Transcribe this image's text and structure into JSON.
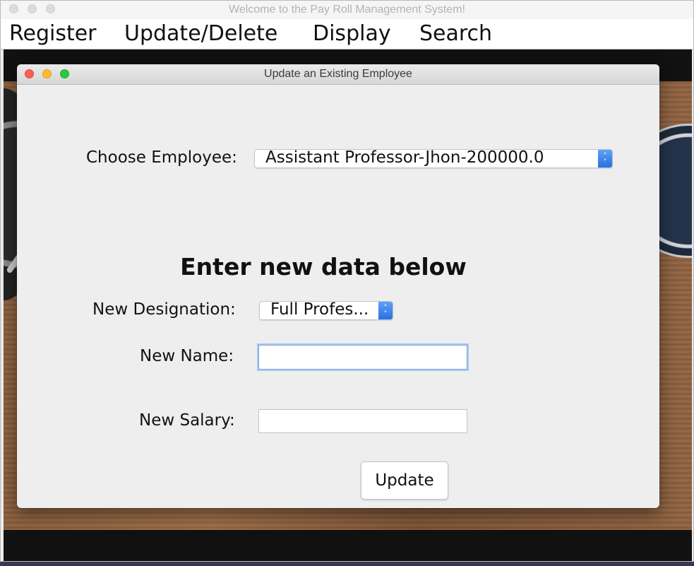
{
  "main_window": {
    "title": "Welcome to the Pay Roll Management System!",
    "menu": [
      "Register",
      "Update/Delete",
      "Display",
      "Search"
    ]
  },
  "dialog": {
    "title": "Update an Existing Employee",
    "choose_employee_label": "Choose Employee:",
    "selected_employee": "Assistant Professor-Jhon-200000.0",
    "heading": "Enter new data below",
    "designation_label": "New Designation:",
    "selected_designation": "Full Profes...",
    "name_label": "New Name:",
    "name_value": "",
    "salary_label": "New Salary:",
    "salary_value": "",
    "update_button": "Update"
  },
  "icons": {
    "combo_arrows": "chevron-up-down-icon",
    "window_close": "close-icon",
    "window_minimize": "minimize-icon",
    "window_zoom": "zoom-icon"
  }
}
